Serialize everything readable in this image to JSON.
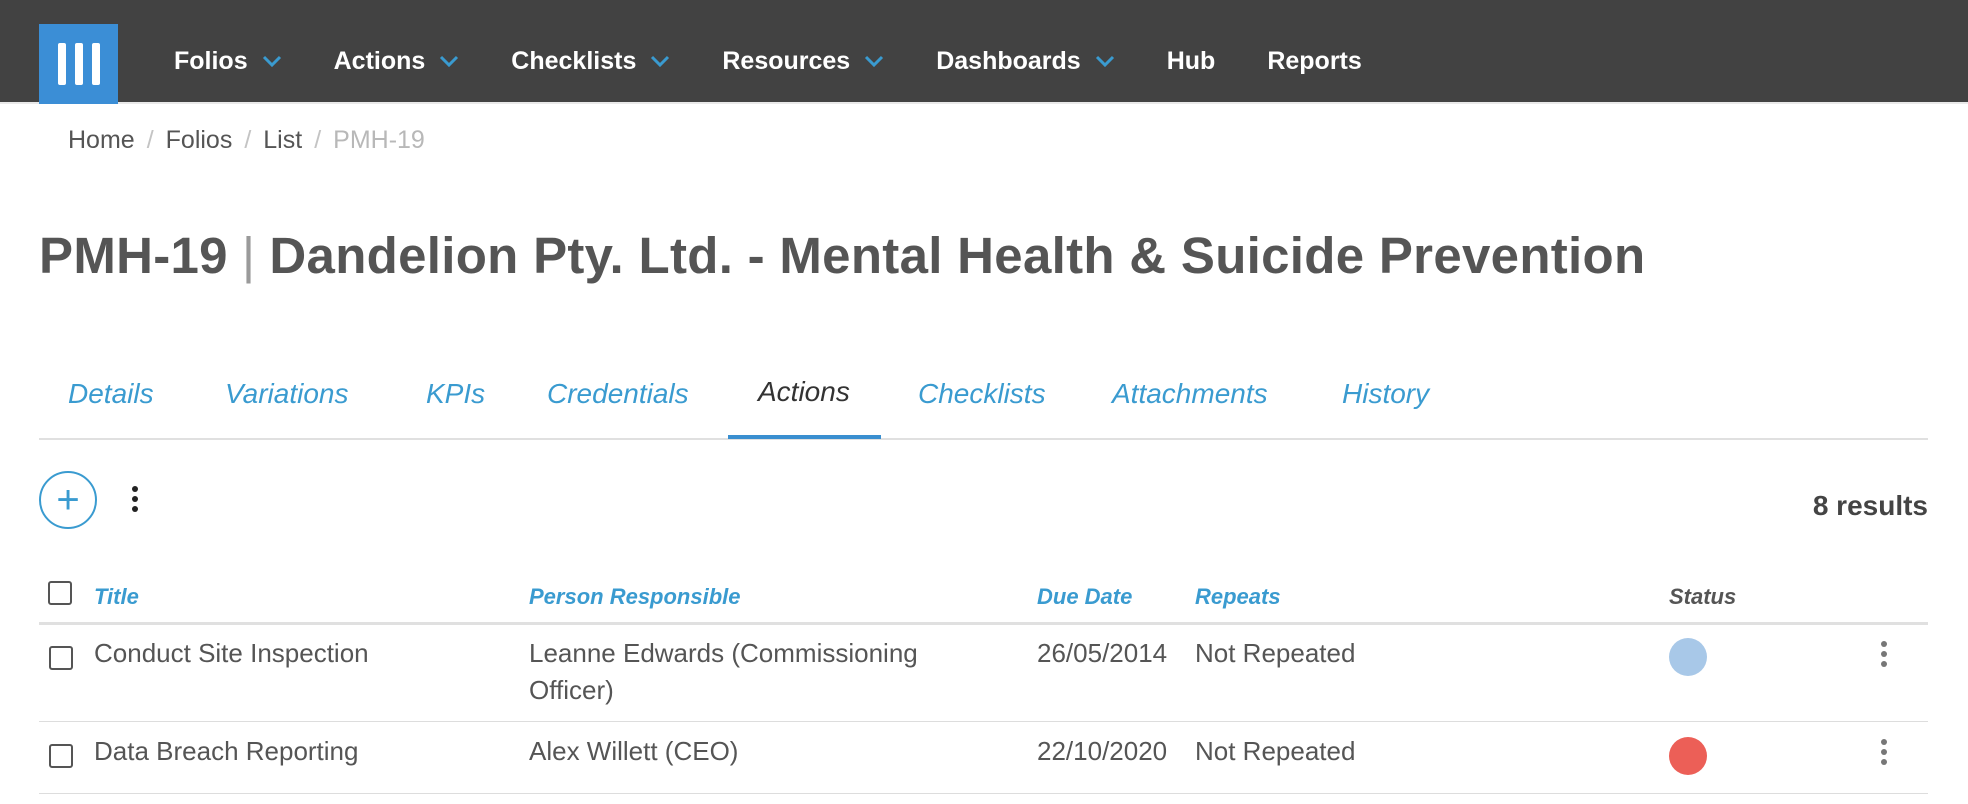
{
  "nav": {
    "logo_icon": "menu-bars-icon",
    "items": [
      {
        "label": "Folios",
        "has_dropdown": true
      },
      {
        "label": "Actions",
        "has_dropdown": true
      },
      {
        "label": "Checklists",
        "has_dropdown": true
      },
      {
        "label": "Resources",
        "has_dropdown": true
      },
      {
        "label": "Dashboards",
        "has_dropdown": true
      },
      {
        "label": "Hub",
        "has_dropdown": false
      },
      {
        "label": "Reports",
        "has_dropdown": false
      }
    ]
  },
  "breadcrumb": [
    "Home",
    "Folios",
    "List",
    "PMH-19"
  ],
  "title": {
    "code": "PMH-19",
    "separator": "|",
    "name": "Dandelion Pty. Ltd. - Mental Health & Suicide Prevention"
  },
  "tabs": [
    {
      "label": "Details",
      "active": false
    },
    {
      "label": "Variations",
      "active": false
    },
    {
      "label": "KPIs",
      "active": false
    },
    {
      "label": "Credentials",
      "active": false
    },
    {
      "label": "Actions",
      "active": true
    },
    {
      "label": "Checklists",
      "active": false
    },
    {
      "label": "Attachments",
      "active": false
    },
    {
      "label": "History",
      "active": false
    }
  ],
  "toolbar": {
    "add_label": "+",
    "results": "8 results"
  },
  "table": {
    "headers": {
      "title": "Title",
      "person": "Person Responsible",
      "due": "Due Date",
      "repeats": "Repeats",
      "status": "Status"
    },
    "rows": [
      {
        "title": "Conduct Site Inspection",
        "person": "Leanne Edwards (Commissioning Officer)",
        "due": "26/05/2014",
        "repeats": "Not Repeated",
        "status_color": "#a8c8e8"
      },
      {
        "title": "Data Breach Reporting",
        "person": "Alex Willett (CEO)",
        "due": "22/10/2020",
        "repeats": "Not Repeated",
        "status_color": "#ec5f57"
      }
    ]
  },
  "colors": {
    "topbar": "#424242",
    "brand": "#3b8ed6",
    "link": "#3a9bd0"
  }
}
